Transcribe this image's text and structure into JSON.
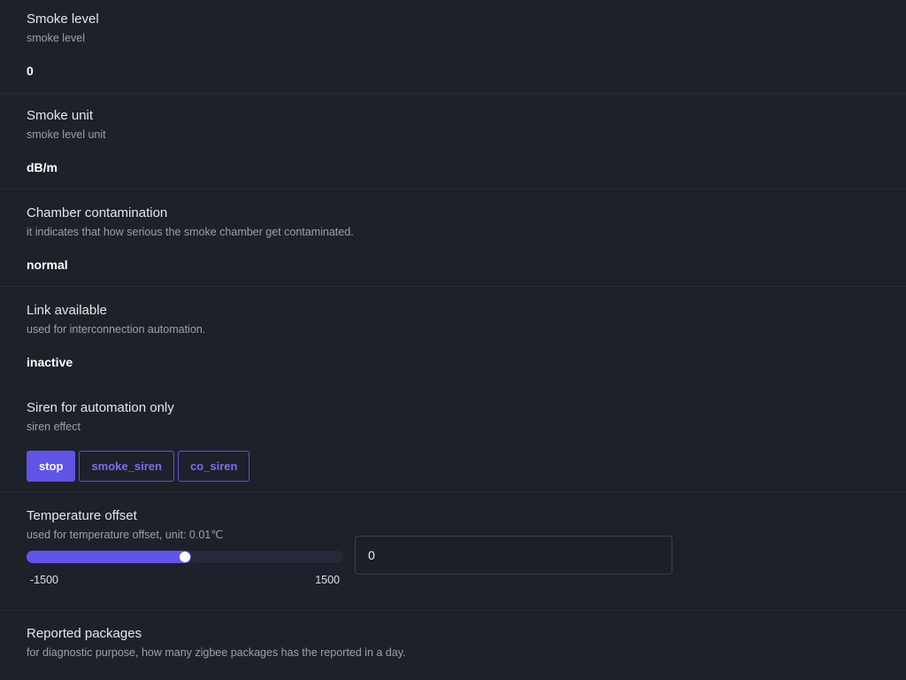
{
  "properties": {
    "smoke_level": {
      "title": "Smoke level",
      "description": "smoke level",
      "value": "0"
    },
    "smoke_unit": {
      "title": "Smoke unit",
      "description": "smoke level unit",
      "value": "dB/m"
    },
    "chamber_contamination": {
      "title": "Chamber contamination",
      "description": "it indicates that how serious the smoke chamber get contaminated.",
      "value": "normal"
    },
    "link_available": {
      "title": "Link available",
      "description": "used for interconnection automation.",
      "value": "inactive"
    },
    "siren": {
      "title": "Siren for automation only",
      "description": "siren effect",
      "options": [
        "stop",
        "smoke_siren",
        "co_siren"
      ],
      "selected": "stop"
    },
    "temperature_offset": {
      "title": "Temperature offset",
      "description": "used for temperature offset, unit: 0.01℃",
      "min_label": "-1500",
      "max_label": "1500",
      "min": -1500,
      "max": 1500,
      "slider_value": 0,
      "input_value": "0"
    },
    "reported_packages": {
      "title": "Reported packages",
      "description": "for diagnostic purpose, how many zigbee packages has the reported in a day."
    }
  },
  "colors": {
    "background": "#1d212a",
    "accent": "#5f55e6",
    "divider": "#272c36"
  }
}
